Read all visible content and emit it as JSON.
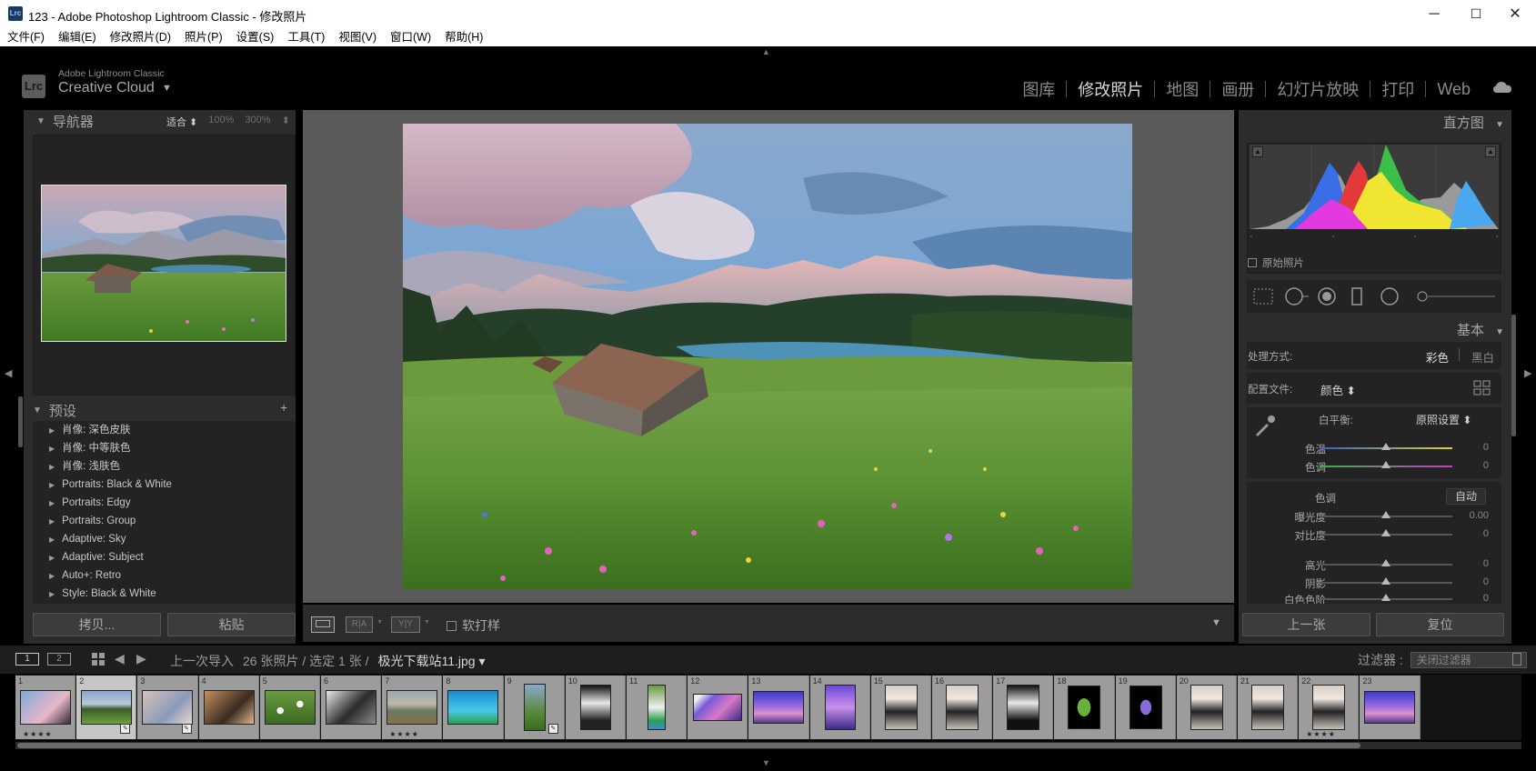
{
  "window": {
    "title": "123 - Adobe Photoshop Lightroom Classic - 修改照片",
    "app_icon": "Lrc",
    "minimize": "─",
    "maximize": "☐",
    "close": "✕"
  },
  "menu": [
    "文件(F)",
    "编辑(E)",
    "修改照片(D)",
    "照片(P)",
    "设置(S)",
    "工具(T)",
    "视图(V)",
    "窗口(W)",
    "帮助(H)"
  ],
  "identity": {
    "logo": "Lrc",
    "small": "Adobe Lightroom Classic",
    "big": "Creative Cloud",
    "caret": "▼"
  },
  "modules": [
    "图库",
    "修改照片",
    "地图",
    "画册",
    "幻灯片放映",
    "打印",
    "Web"
  ],
  "active_module": "修改照片",
  "navigator": {
    "title": "导航器",
    "fit": "适合 ⬍",
    "z100": "100%",
    "z300": "300%",
    "more": "⬍"
  },
  "presets": {
    "title": "预设",
    "add": "+",
    "items": [
      "肖像: 深色皮肤",
      "肖像: 中等肤色",
      "肖像: 浅肤色",
      "Portraits: Black & White",
      "Portraits: Edgy",
      "Portraits: Group",
      "Adaptive: Sky",
      "Adaptive: Subject",
      "Auto+: Retro",
      "Style: Black & White"
    ]
  },
  "left_buttons": {
    "copy": "拷贝...",
    "paste": "粘贴"
  },
  "toolbar": {
    "view_ra": "R|A",
    "view_yy": "Y|Y",
    "soft_proof": "软打样",
    "menu_arrow": "▼"
  },
  "histogram": {
    "title": "直方图",
    "original_photo": "原始照片",
    "ticks": [
      "-",
      "-",
      "-",
      "-"
    ]
  },
  "basic": {
    "title": "基本",
    "treatment_label": "处理方式:",
    "color": "彩色",
    "bw": "黑白",
    "profile_label": "配置文件:",
    "profile_value": "颜色 ⬍",
    "wb_label": "白平衡:",
    "wb_value": "原照设置 ⬍",
    "tone_label": "色调",
    "auto": "自动",
    "sliders": [
      {
        "label": "色温",
        "value": "0",
        "pos": 0.5
      },
      {
        "label": "色调",
        "value": "0",
        "pos": 0.5
      },
      {
        "label": "曝光度",
        "value": "0.00",
        "pos": 0.5
      },
      {
        "label": "对比度",
        "value": "0",
        "pos": 0.5
      },
      {
        "label": "高光",
        "value": "0",
        "pos": 0.5
      },
      {
        "label": "阴影",
        "value": "0",
        "pos": 0.5
      },
      {
        "label": "白色色阶",
        "value": "0",
        "pos": 0.5
      }
    ]
  },
  "right_buttons": {
    "prev": "上一张",
    "reset": "复位"
  },
  "filmbar": {
    "screen1": "1",
    "screen2": "2",
    "source": "上一次导入",
    "count": "26 张照片 / 选定 1 张 /",
    "current_file": "极光下载站11.jpg ▾",
    "filter_label": "过滤器 :",
    "filter_value": "关闭过滤器"
  },
  "filmstrip": [
    {
      "n": "1",
      "stars": "★★★★",
      "badge": false,
      "kind": "portrait-blue"
    },
    {
      "n": "2",
      "stars": "",
      "badge": true,
      "kind": "meadow",
      "selected": true
    },
    {
      "n": "3",
      "stars": "",
      "badge": true,
      "kind": "portrait-pale"
    },
    {
      "n": "4",
      "stars": "",
      "badge": false,
      "kind": "portrait-warm"
    },
    {
      "n": "5",
      "stars": "",
      "badge": false,
      "kind": "flowers"
    },
    {
      "n": "6",
      "stars": "",
      "badge": false,
      "kind": "portrait-dark"
    },
    {
      "n": "7",
      "stars": "★★★★",
      "badge": false,
      "kind": "lake"
    },
    {
      "n": "8",
      "stars": "",
      "badge": false,
      "kind": "cyan"
    },
    {
      "n": "9",
      "stars": "",
      "badge": true,
      "kind": "tall-green"
    },
    {
      "n": "10",
      "stars": "",
      "badge": false,
      "kind": "girl-black"
    },
    {
      "n": "11",
      "stars": "",
      "badge": false,
      "kind": "tall-field"
    },
    {
      "n": "12",
      "stars": "",
      "badge": false,
      "kind": "purple-wide"
    },
    {
      "n": "13",
      "stars": "",
      "badge": false,
      "kind": "purple-sky"
    },
    {
      "n": "14",
      "stars": "",
      "badge": false,
      "kind": "purple-tall"
    },
    {
      "n": "15",
      "stars": "",
      "badge": false,
      "kind": "girl"
    },
    {
      "n": "16",
      "stars": "",
      "badge": false,
      "kind": "girl"
    },
    {
      "n": "17",
      "stars": "",
      "badge": false,
      "kind": "girl-dark"
    },
    {
      "n": "18",
      "stars": "",
      "badge": false,
      "kind": "black-green"
    },
    {
      "n": "19",
      "stars": "",
      "badge": false,
      "kind": "black-purple"
    },
    {
      "n": "20",
      "stars": "",
      "badge": false,
      "kind": "girl"
    },
    {
      "n": "21",
      "stars": "",
      "badge": false,
      "kind": "girl"
    },
    {
      "n": "22",
      "stars": "★★★★",
      "badge": false,
      "kind": "girl"
    },
    {
      "n": "23",
      "stars": "",
      "badge": false,
      "kind": "purple-sky"
    }
  ],
  "colors": {
    "panel": "#2c2c2c",
    "center_bg": "#5a5a5a",
    "filmstrip_cell": "#9c9c9c"
  },
  "icons": {
    "up": "up-arrow-icon",
    "down": "down-arrow-icon",
    "cloud": "cloud-sync-icon",
    "eyedropper": "white-balance-eyedropper-icon"
  }
}
